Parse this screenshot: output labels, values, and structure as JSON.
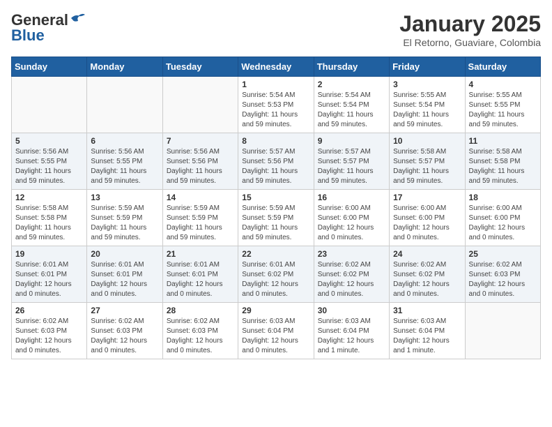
{
  "header": {
    "logo_general": "General",
    "logo_blue": "Blue",
    "month_title": "January 2025",
    "subtitle": "El Retorno, Guaviare, Colombia"
  },
  "days_of_week": [
    "Sunday",
    "Monday",
    "Tuesday",
    "Wednesday",
    "Thursday",
    "Friday",
    "Saturday"
  ],
  "weeks": [
    [
      {
        "day": "",
        "info": ""
      },
      {
        "day": "",
        "info": ""
      },
      {
        "day": "",
        "info": ""
      },
      {
        "day": "1",
        "info": "Sunrise: 5:54 AM\nSunset: 5:53 PM\nDaylight: 11 hours\nand 59 minutes."
      },
      {
        "day": "2",
        "info": "Sunrise: 5:54 AM\nSunset: 5:54 PM\nDaylight: 11 hours\nand 59 minutes."
      },
      {
        "day": "3",
        "info": "Sunrise: 5:55 AM\nSunset: 5:54 PM\nDaylight: 11 hours\nand 59 minutes."
      },
      {
        "day": "4",
        "info": "Sunrise: 5:55 AM\nSunset: 5:55 PM\nDaylight: 11 hours\nand 59 minutes."
      }
    ],
    [
      {
        "day": "5",
        "info": "Sunrise: 5:56 AM\nSunset: 5:55 PM\nDaylight: 11 hours\nand 59 minutes."
      },
      {
        "day": "6",
        "info": "Sunrise: 5:56 AM\nSunset: 5:55 PM\nDaylight: 11 hours\nand 59 minutes."
      },
      {
        "day": "7",
        "info": "Sunrise: 5:56 AM\nSunset: 5:56 PM\nDaylight: 11 hours\nand 59 minutes."
      },
      {
        "day": "8",
        "info": "Sunrise: 5:57 AM\nSunset: 5:56 PM\nDaylight: 11 hours\nand 59 minutes."
      },
      {
        "day": "9",
        "info": "Sunrise: 5:57 AM\nSunset: 5:57 PM\nDaylight: 11 hours\nand 59 minutes."
      },
      {
        "day": "10",
        "info": "Sunrise: 5:58 AM\nSunset: 5:57 PM\nDaylight: 11 hours\nand 59 minutes."
      },
      {
        "day": "11",
        "info": "Sunrise: 5:58 AM\nSunset: 5:58 PM\nDaylight: 11 hours\nand 59 minutes."
      }
    ],
    [
      {
        "day": "12",
        "info": "Sunrise: 5:58 AM\nSunset: 5:58 PM\nDaylight: 11 hours\nand 59 minutes."
      },
      {
        "day": "13",
        "info": "Sunrise: 5:59 AM\nSunset: 5:59 PM\nDaylight: 11 hours\nand 59 minutes."
      },
      {
        "day": "14",
        "info": "Sunrise: 5:59 AM\nSunset: 5:59 PM\nDaylight: 11 hours\nand 59 minutes."
      },
      {
        "day": "15",
        "info": "Sunrise: 5:59 AM\nSunset: 5:59 PM\nDaylight: 11 hours\nand 59 minutes."
      },
      {
        "day": "16",
        "info": "Sunrise: 6:00 AM\nSunset: 6:00 PM\nDaylight: 12 hours\nand 0 minutes."
      },
      {
        "day": "17",
        "info": "Sunrise: 6:00 AM\nSunset: 6:00 PM\nDaylight: 12 hours\nand 0 minutes."
      },
      {
        "day": "18",
        "info": "Sunrise: 6:00 AM\nSunset: 6:00 PM\nDaylight: 12 hours\nand 0 minutes."
      }
    ],
    [
      {
        "day": "19",
        "info": "Sunrise: 6:01 AM\nSunset: 6:01 PM\nDaylight: 12 hours\nand 0 minutes."
      },
      {
        "day": "20",
        "info": "Sunrise: 6:01 AM\nSunset: 6:01 PM\nDaylight: 12 hours\nand 0 minutes."
      },
      {
        "day": "21",
        "info": "Sunrise: 6:01 AM\nSunset: 6:01 PM\nDaylight: 12 hours\nand 0 minutes."
      },
      {
        "day": "22",
        "info": "Sunrise: 6:01 AM\nSunset: 6:02 PM\nDaylight: 12 hours\nand 0 minutes."
      },
      {
        "day": "23",
        "info": "Sunrise: 6:02 AM\nSunset: 6:02 PM\nDaylight: 12 hours\nand 0 minutes."
      },
      {
        "day": "24",
        "info": "Sunrise: 6:02 AM\nSunset: 6:02 PM\nDaylight: 12 hours\nand 0 minutes."
      },
      {
        "day": "25",
        "info": "Sunrise: 6:02 AM\nSunset: 6:03 PM\nDaylight: 12 hours\nand 0 minutes."
      }
    ],
    [
      {
        "day": "26",
        "info": "Sunrise: 6:02 AM\nSunset: 6:03 PM\nDaylight: 12 hours\nand 0 minutes."
      },
      {
        "day": "27",
        "info": "Sunrise: 6:02 AM\nSunset: 6:03 PM\nDaylight: 12 hours\nand 0 minutes."
      },
      {
        "day": "28",
        "info": "Sunrise: 6:02 AM\nSunset: 6:03 PM\nDaylight: 12 hours\nand 0 minutes."
      },
      {
        "day": "29",
        "info": "Sunrise: 6:03 AM\nSunset: 6:04 PM\nDaylight: 12 hours\nand 0 minutes."
      },
      {
        "day": "30",
        "info": "Sunrise: 6:03 AM\nSunset: 6:04 PM\nDaylight: 12 hours\nand 1 minute."
      },
      {
        "day": "31",
        "info": "Sunrise: 6:03 AM\nSunset: 6:04 PM\nDaylight: 12 hours\nand 1 minute."
      },
      {
        "day": "",
        "info": ""
      }
    ]
  ]
}
